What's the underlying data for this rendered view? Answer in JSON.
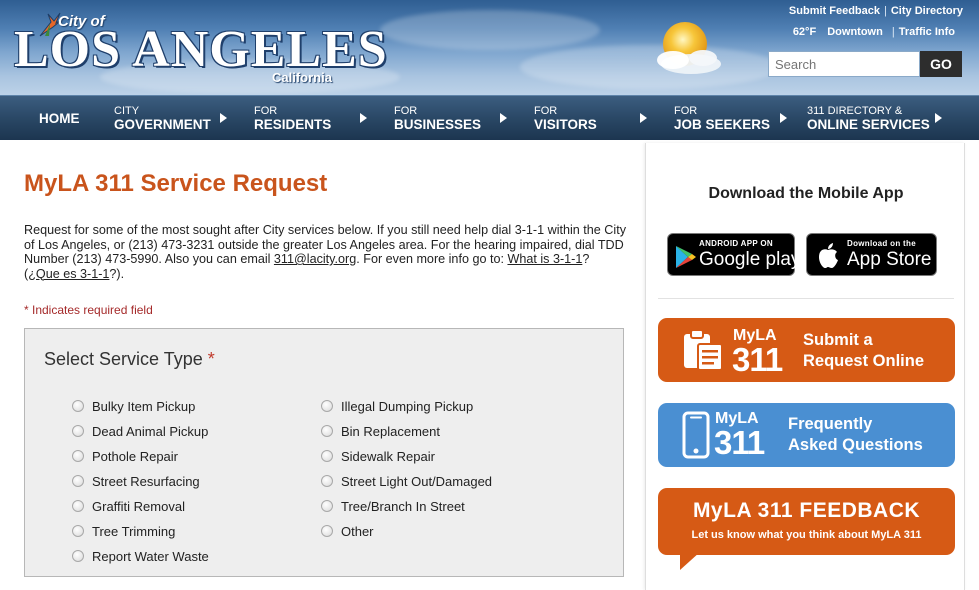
{
  "header": {
    "logo_city": "City of",
    "logo_name": "LOS ANGELES",
    "logo_state": "California",
    "links": [
      "Submit Feedback",
      "City Directory"
    ],
    "weather_temp": "62°F",
    "weather_location": "Downtown",
    "traffic_link": "Traffic Info",
    "search_placeholder": "Search",
    "search_button": "GO"
  },
  "nav": [
    {
      "small": "",
      "big": "HOME"
    },
    {
      "small": "CITY",
      "big": "GOVERNMENT"
    },
    {
      "small": "FOR",
      "big": "RESIDENTS"
    },
    {
      "small": "FOR",
      "big": "BUSINESSES"
    },
    {
      "small": "FOR",
      "big": "VISITORS"
    },
    {
      "small": "FOR",
      "big": "JOB SEEKERS"
    },
    {
      "small": "311 DIRECTORY &",
      "big": "ONLINE SERVICES"
    }
  ],
  "main": {
    "title": "MyLA 311 Service Request",
    "intro_1": "Request for some of the most sought after City services below.  If you still need help dial 3-1-1 within the City of Los Angeles, or (213) 473-3231 outside the greater Los Angeles area.  For the hearing impaired, dial TDD Number (213) 473-5990.  Also you can email ",
    "intro_email": "311@lacity.org",
    "intro_2": ".  For even more info go to: ",
    "intro_link1": "What is 3-1-1",
    "intro_3": "? (",
    "intro_link2": "¿Que es 3-1-1",
    "intro_4": "?).",
    "required_note": "* Indicates required field",
    "service_heading": "Select Service Type",
    "required_mark": "*",
    "services_left": [
      "Bulky Item Pickup",
      "Dead Animal Pickup",
      "Pothole Repair",
      "Street Resurfacing",
      "Graffiti Removal",
      "Tree Trimming",
      "Report Water Waste"
    ],
    "services_right": [
      "Illegal Dumping Pickup",
      "Bin Replacement",
      "Sidewalk Repair",
      "Street Light Out/Damaged",
      "Tree/Branch In Street",
      "Other"
    ]
  },
  "sidebar": {
    "title": "Download the Mobile App",
    "google_small": "ANDROID APP ON",
    "google_big": "Google play",
    "apple_small": "Download on the",
    "apple_big": "App Store",
    "promo1_my": "MyLA",
    "promo1_num": "311",
    "promo1_text_1": "Submit a",
    "promo1_text_2": "Request Online",
    "promo2_my": "MyLA",
    "promo2_num": "311",
    "promo2_text_1": "Frequently",
    "promo2_text_2": "Asked Questions",
    "feedback_title": "MyLA 311 FEEDBACK",
    "feedback_sub": "Let us know what you think about MyLA 311"
  },
  "colors": {
    "accent_orange": "#d65a15",
    "accent_blue": "#4a8fd2",
    "title_orange": "#c9541c",
    "nav_dark": "#2a4866"
  }
}
